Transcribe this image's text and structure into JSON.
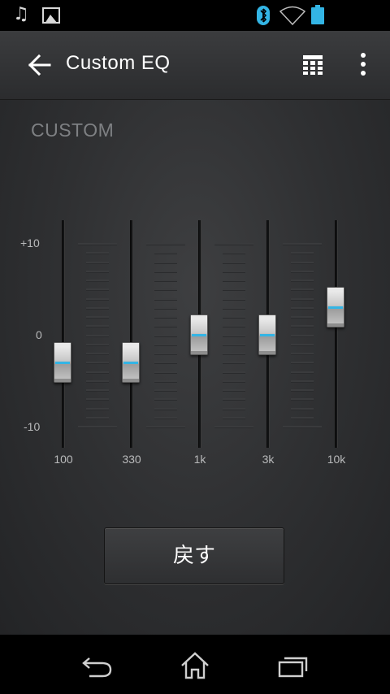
{
  "statusbar": {
    "icons": [
      "music-note-icon",
      "gallery-icon",
      "bluetooth-icon",
      "wifi-icon",
      "battery-icon"
    ]
  },
  "actionbar": {
    "title": "Custom EQ",
    "icons": [
      "back-arrow-icon",
      "grid-icon",
      "overflow-menu-icon"
    ]
  },
  "main": {
    "preset_name": "CUSTOM",
    "db_scale": {
      "top": "+10",
      "middle": "0",
      "bottom": "-10"
    },
    "bands": [
      {
        "label": "100",
        "level_db": -3
      },
      {
        "label": "330",
        "level_db": -3
      },
      {
        "label": "1k",
        "level_db": 0
      },
      {
        "label": "3k",
        "level_db": 0
      },
      {
        "label": "10k",
        "level_db": 3
      }
    ],
    "reset_label": "戻す"
  },
  "navbar": {
    "icons": [
      "nav-back-icon",
      "nav-home-icon",
      "nav-recent-apps-icon"
    ]
  },
  "colors": {
    "accent": "#33b5e5",
    "actionbar": "#333436",
    "background": "#2f3032"
  }
}
